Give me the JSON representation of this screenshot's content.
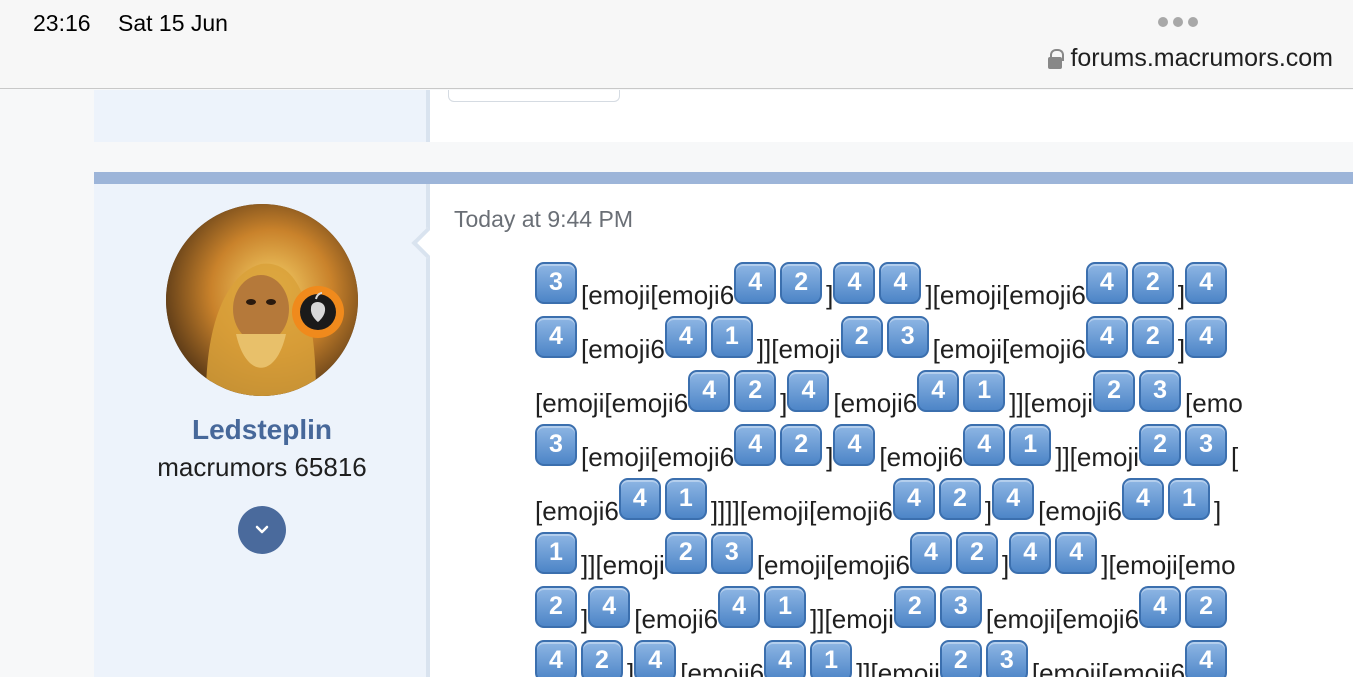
{
  "status_bar": {
    "time": "23:16",
    "date": "Sat 15 Jun"
  },
  "browser": {
    "url": "forums.macrumors.com"
  },
  "post": {
    "author": {
      "username": "Ledsteplin",
      "title": "macrumors 65816"
    },
    "timestamp": "Today at 9:44 PM",
    "lines": [
      [
        {
          "k": "3"
        },
        {
          "t": "[emoji[emoji6"
        },
        {
          "k": "4"
        },
        {
          "k": "2"
        },
        {
          "t": "]"
        },
        {
          "k": "4"
        },
        {
          "k": "4"
        },
        {
          "t": "][emoji[emoji6"
        },
        {
          "k": "4"
        },
        {
          "k": "2"
        },
        {
          "t": "]"
        },
        {
          "k": "4"
        }
      ],
      [
        {
          "k": "4"
        },
        {
          "t": "[emoji6"
        },
        {
          "k": "4"
        },
        {
          "k": "1"
        },
        {
          "t": "]][emoji"
        },
        {
          "k": "2"
        },
        {
          "k": "3"
        },
        {
          "t": "[emoji[emoji6"
        },
        {
          "k": "4"
        },
        {
          "k": "2"
        },
        {
          "t": "]"
        },
        {
          "k": "4"
        }
      ],
      [
        {
          "t": "[emoji[emoji6"
        },
        {
          "k": "4"
        },
        {
          "k": "2"
        },
        {
          "t": "]"
        },
        {
          "k": "4"
        },
        {
          "t": "[emoji6"
        },
        {
          "k": "4"
        },
        {
          "k": "1"
        },
        {
          "t": "]][emoji"
        },
        {
          "k": "2"
        },
        {
          "k": "3"
        },
        {
          "t": "[emo"
        }
      ],
      [
        {
          "k": "3"
        },
        {
          "t": "[emoji[emoji6"
        },
        {
          "k": "4"
        },
        {
          "k": "2"
        },
        {
          "t": "]"
        },
        {
          "k": "4"
        },
        {
          "t": "[emoji6"
        },
        {
          "k": "4"
        },
        {
          "k": "1"
        },
        {
          "t": "]][emoji"
        },
        {
          "k": "2"
        },
        {
          "k": "3"
        },
        {
          "t": "["
        }
      ],
      [
        {
          "t": "[emoji6"
        },
        {
          "k": "4"
        },
        {
          "k": "1"
        },
        {
          "t": "]]]][emoji[emoji6"
        },
        {
          "k": "4"
        },
        {
          "k": "2"
        },
        {
          "t": "]"
        },
        {
          "k": "4"
        },
        {
          "t": "[emoji6"
        },
        {
          "k": "4"
        },
        {
          "k": "1"
        },
        {
          "t": "]"
        }
      ],
      [
        {
          "k": "1"
        },
        {
          "t": "]][emoji"
        },
        {
          "k": "2"
        },
        {
          "k": "3"
        },
        {
          "t": "[emoji[emoji6"
        },
        {
          "k": "4"
        },
        {
          "k": "2"
        },
        {
          "t": "]"
        },
        {
          "k": "4"
        },
        {
          "k": "4"
        },
        {
          "t": "][emoji[emo"
        }
      ],
      [
        {
          "k": "2"
        },
        {
          "t": "]"
        },
        {
          "k": "4"
        },
        {
          "t": "[emoji6"
        },
        {
          "k": "4"
        },
        {
          "k": "1"
        },
        {
          "t": "]][emoji"
        },
        {
          "k": "2"
        },
        {
          "k": "3"
        },
        {
          "t": "[emoji[emoji6"
        },
        {
          "k": "4"
        },
        {
          "k": "2"
        }
      ],
      [
        {
          "k": "4"
        },
        {
          "k": "2"
        },
        {
          "t": "]"
        },
        {
          "k": "4"
        },
        {
          "t": "[emoji6"
        },
        {
          "k": "4"
        },
        {
          "k": "1"
        },
        {
          "t": "]][emoji"
        },
        {
          "k": "2"
        },
        {
          "k": "3"
        },
        {
          "t": "[emoji[emoji6"
        },
        {
          "k": "4"
        }
      ]
    ]
  },
  "colors": {
    "accent": "#47689a",
    "post_bar": "#9db5d9",
    "user_bg": "#edf3fb",
    "keycap": "#4d85c7"
  }
}
